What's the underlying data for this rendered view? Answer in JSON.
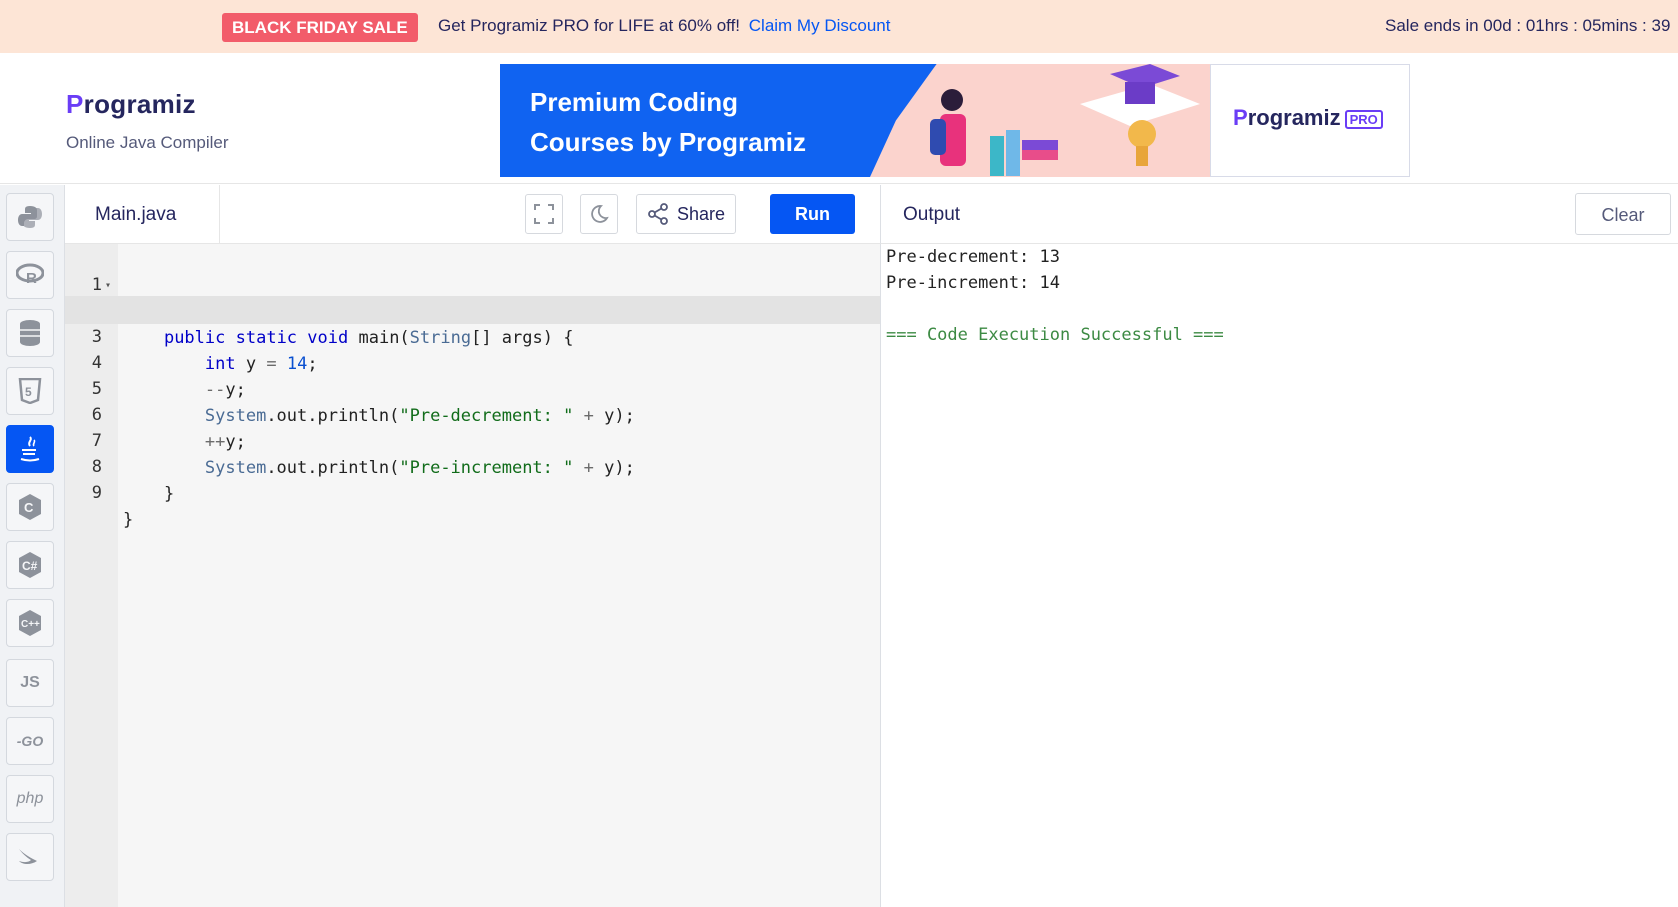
{
  "promo": {
    "badge": "BLACK FRIDAY SALE",
    "text": "Get Programiz PRO for LIFE at 60% off!",
    "link": "Claim My Discount",
    "timer": "Sale ends in 00d : 01hrs : 05mins : 39"
  },
  "header": {
    "logo_first": "P",
    "logo_rest": "rogramiz",
    "subtitle": "Online Java Compiler"
  },
  "banner": {
    "headline_line1": "Premium Coding",
    "headline_line2": "Courses by Programiz",
    "logo_first": "P",
    "logo_rest": "rogramiz",
    "pro": "PRO"
  },
  "sidebar": {
    "languages": [
      {
        "name": "python-icon",
        "label": ""
      },
      {
        "name": "r-icon",
        "label": ""
      },
      {
        "name": "sql-icon",
        "label": ""
      },
      {
        "name": "html-icon",
        "label": ""
      },
      {
        "name": "java-icon",
        "label": ""
      },
      {
        "name": "c-icon",
        "label": ""
      },
      {
        "name": "csharp-icon",
        "label": ""
      },
      {
        "name": "cpp-icon",
        "label": ""
      },
      {
        "name": "js-icon",
        "label": "JS"
      },
      {
        "name": "go-icon",
        "label": "-GO"
      },
      {
        "name": "php-icon",
        "label": "php"
      },
      {
        "name": "swift-icon",
        "label": ""
      }
    ]
  },
  "editor": {
    "filename": "Main.java",
    "share_label": "Share",
    "run_label": "Run"
  },
  "output": {
    "title": "Output",
    "clear_label": "Clear",
    "lines": [
      "Pre-decrement: 13",
      "Pre-increment: 14",
      "",
      "=== Code Execution Successful ==="
    ]
  },
  "colors": {
    "accent": "#0556f3",
    "promo_bg": "#fde5d6",
    "sale_badge": "#f25c6a",
    "brand_purple": "#6a3df6"
  }
}
